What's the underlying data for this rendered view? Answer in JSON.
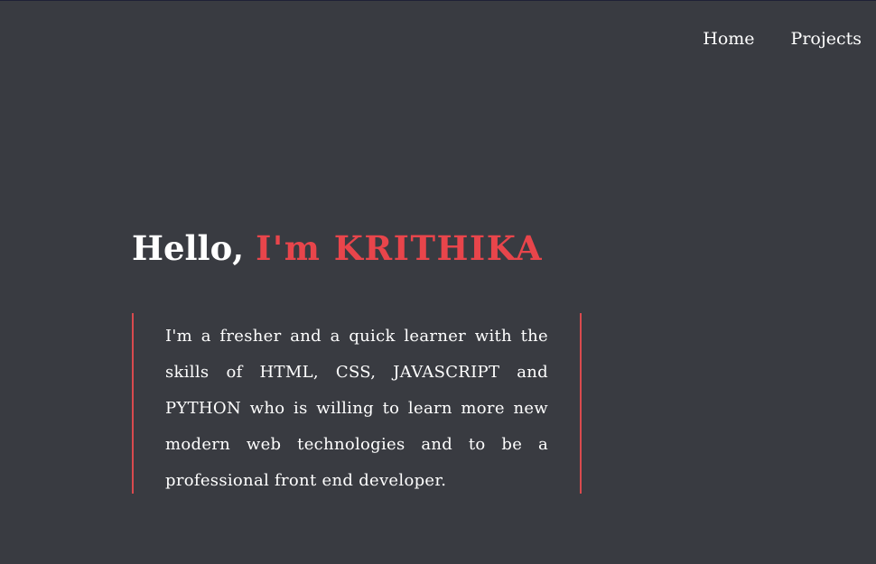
{
  "nav": {
    "items": [
      {
        "label": "Home"
      },
      {
        "label": "Projects"
      }
    ]
  },
  "hero": {
    "greeting": "Hello, ",
    "name": "I'm KRITHIKA",
    "bio": "I'm a fresher and a quick learner with the skills of HTML, CSS, JAVASCRIPT and PYTHON who is willing to learn more new modern web technologies and to be a professional front end developer."
  },
  "colors": {
    "background": "#393b41",
    "accent": "#e8454b",
    "text": "#ffffff"
  }
}
